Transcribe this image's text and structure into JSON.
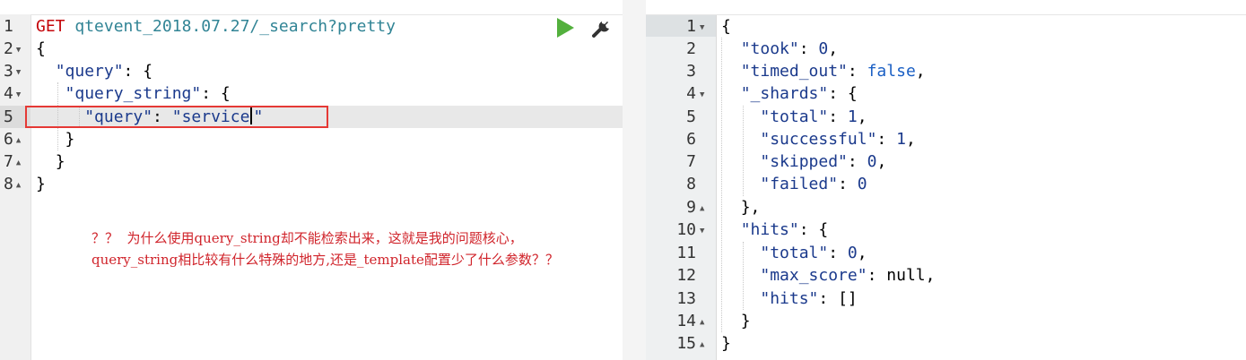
{
  "request": {
    "method": "GET",
    "url": "qtevent_2018.07.27/_search?pretty",
    "lines": [
      {
        "num": "1",
        "fold": ""
      },
      {
        "num": "2",
        "fold": "▼"
      },
      {
        "num": "3",
        "fold": "▼"
      },
      {
        "num": "4",
        "fold": "▼"
      },
      {
        "num": "5",
        "fold": ""
      },
      {
        "num": "6",
        "fold": "▲"
      },
      {
        "num": "7",
        "fold": "▲"
      },
      {
        "num": "8",
        "fold": "▲"
      }
    ],
    "body": {
      "open": "{",
      "query_key": "\"query\"",
      "query_open": ": {",
      "qs_key": "\"query_string\"",
      "qs_open": ": {",
      "inner_key": "\"query\"",
      "sep": ": ",
      "inner_value_a": "\"service",
      "inner_value_b": "\"",
      "close1": "}",
      "close2": "}",
      "close3": "}"
    }
  },
  "annotation": {
    "line1": "？？  为什么使用query_string却不能检索出来，这就是我的问题核心，",
    "line2": "query_string相比较有什么特殊的地方,还是_template配置少了什么参数？？"
  },
  "response": {
    "line_numbers": [
      "1",
      "2",
      "3",
      "4",
      "5",
      "6",
      "7",
      "8",
      "9",
      "10",
      "11",
      "12",
      "13",
      "14",
      "15"
    ],
    "folds": [
      "▼",
      "",
      "",
      "▼",
      "",
      "",
      "",
      "",
      "▲",
      "▼",
      "",
      "",
      "",
      "▲",
      "▲"
    ],
    "open": "{",
    "took_key": "\"took\"",
    "took_val": "0",
    "timed_out_key": "\"timed_out\"",
    "timed_out_val": "false",
    "shards_key": "\"_shards\"",
    "total_key": "\"total\"",
    "total_val": "1",
    "successful_key": "\"successful\"",
    "successful_val": "1",
    "skipped_key": "\"skipped\"",
    "skipped_val": "0",
    "failed_key": "\"failed\"",
    "failed_val": "0",
    "shards_close": "},",
    "hits_key": "\"hits\"",
    "hits_total_key": "\"total\"",
    "hits_total_val": "0",
    "max_score_key": "\"max_score\"",
    "max_score_val": "null",
    "hits_arr_key": "\"hits\"",
    "hits_arr_val": "[]",
    "hits_close": "}",
    "close": "}"
  },
  "colors": {
    "method": "#c5060b",
    "url": "#318495",
    "run": "#53b03d",
    "highlight": "#e53935",
    "annotation": "#d0242b"
  },
  "icons": {
    "run": "play-triangle-icon",
    "settings": "wrench-icon"
  }
}
